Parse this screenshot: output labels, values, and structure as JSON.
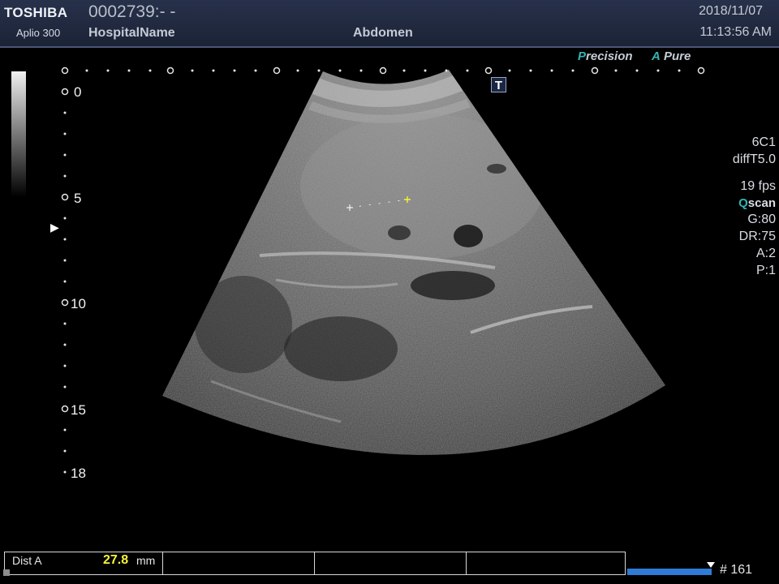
{
  "header": {
    "brand": "TOSHIBA",
    "model": "Aplio 300",
    "patient_id": "0002739:- -",
    "hospital": "HospitalName",
    "preset": "Abdomen",
    "date": "2018/11/07",
    "time": "11:13:56 AM"
  },
  "badges": {
    "precision_initial": "P",
    "precision_rest": "recision",
    "pure_initial": "A",
    "pure_rest": "Pure"
  },
  "transducer_marker": "T",
  "depth_labels": [
    "0",
    "5",
    "10",
    "15",
    "18"
  ],
  "params": {
    "probe": "6C1",
    "mode": "diffT5.0",
    "fps": "19 fps",
    "qscan_q": "Q",
    "qscan_rest": "scan",
    "gain": "G:80",
    "dr": "DR:75",
    "a": "A:2",
    "p": "P:1"
  },
  "measurement": {
    "label": "Dist A",
    "value": "27.8",
    "unit": "mm"
  },
  "cine": {
    "frame": "# 161"
  },
  "colors": {
    "header_bg": "#1f2840",
    "accent_teal": "#34b4b4",
    "measure_value": "#f6f43a",
    "cine_bar": "#2f7bd6"
  }
}
